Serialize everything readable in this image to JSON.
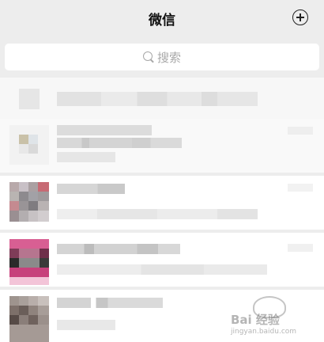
{
  "header": {
    "title": "微信",
    "add_icon": "plus-circle-icon"
  },
  "search": {
    "placeholder": "搜索",
    "icon": "search-icon"
  },
  "watermark": {
    "main": "Bai 经验",
    "sub": "jingyan.baidu.com"
  },
  "colors": {
    "background": "#ededed",
    "list_background": "#ffffff",
    "pinned_row_background": "#f7f7f7"
  }
}
